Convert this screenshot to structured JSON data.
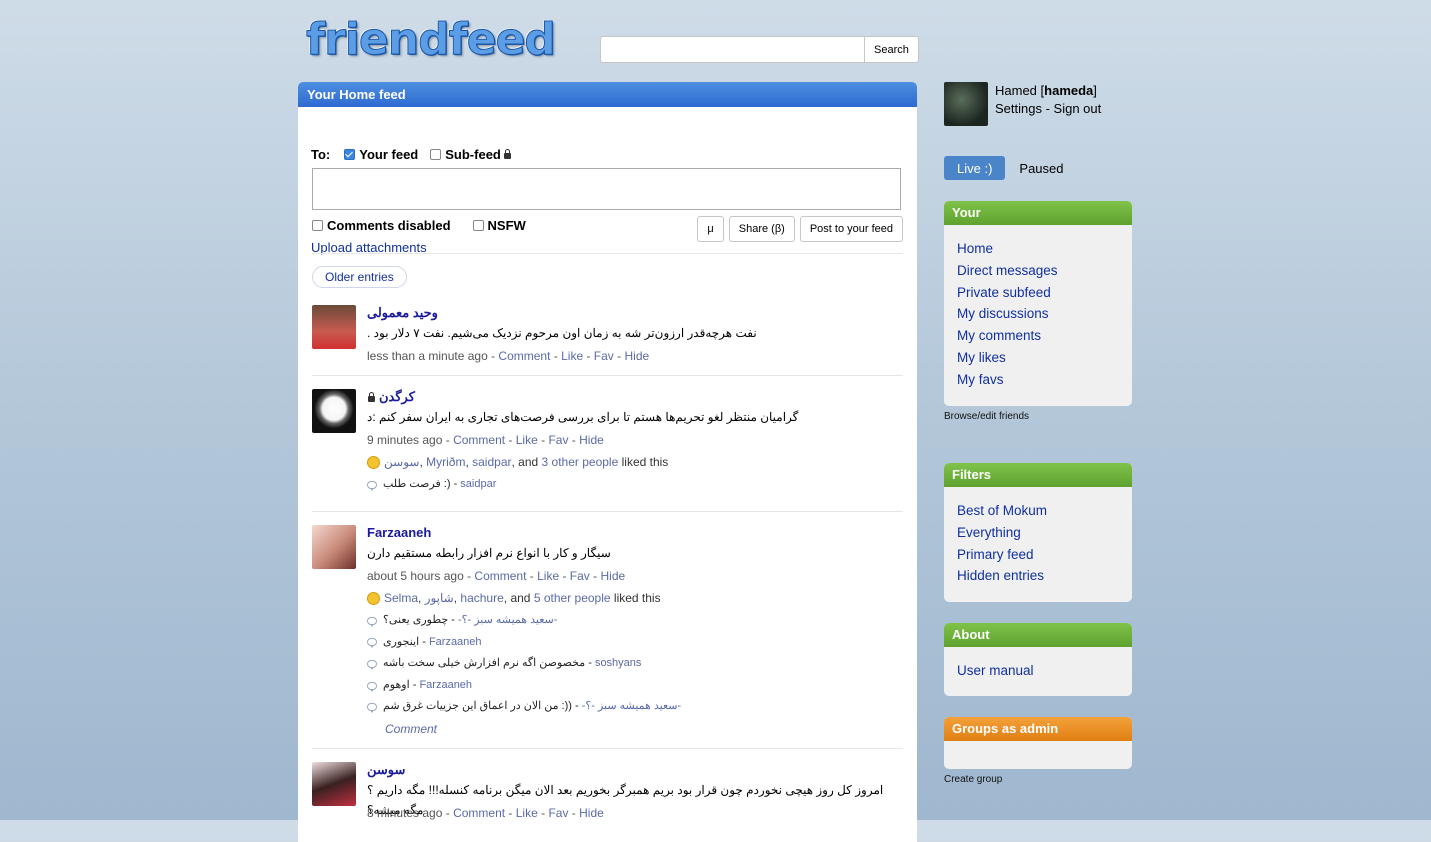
{
  "logo": "friendfeed",
  "search": {
    "placeholder": "",
    "button": "Search"
  },
  "feed": {
    "title": "Your Home feed",
    "to_label": "To:",
    "your_feed": "Your feed",
    "sub_feed": "Sub-feed",
    "comments_disabled": "Comments disabled",
    "nsfw": "NSFW",
    "upload": "Upload attachments",
    "mu_button": "μ",
    "share_button": "Share (β)",
    "post_button": "Post to your feed",
    "older": "Older entries"
  },
  "entries": [
    {
      "author": "وحید معمولی",
      "text": ". نفت هرچه‌قدر ارزون‌تر شه به زمان اون مرحوم نزدیک می‌شیم. نفت ۷ دلار بود",
      "time": "less than a minute ago",
      "actions": [
        "Comment",
        "Like",
        "Fav",
        "Hide"
      ]
    },
    {
      "author": "کرگدن",
      "text": "گرامیان منتظر لغو تحریم‌ها هستم تا برای بررسی فرصت‌های تجاری به ایران سفر کنم :د",
      "time": "9 minutes ago",
      "actions": [
        "Comment",
        "Like",
        "Fav",
        "Hide"
      ],
      "likes": {
        "names": [
          "سوسن",
          "Myriðm",
          "saidpar"
        ],
        "and": ", and",
        "others": "3 other people",
        "suffix": "liked this"
      },
      "comments": [
        {
          "text": "فرصت طلب :)",
          "author": "saidpar"
        }
      ]
    },
    {
      "author": "Farzaaneh",
      "text": "سیگار و کار با انواع نرم افزار رابطه مستقیم دارن",
      "time": "about 5 hours ago",
      "actions": [
        "Comment",
        "Like",
        "Fav",
        "Hide"
      ],
      "likes": {
        "names": [
          "Selma",
          "شاپور",
          "hachure"
        ],
        "and": ", and",
        "others": "5 other people",
        "suffix": "liked this"
      },
      "comments": [
        {
          "text": "چطوری یعنی؟",
          "author": "-سعید همیشه سبز -؟-"
        },
        {
          "text": "اینجوری",
          "author": "Farzaaneh"
        },
        {
          "text": "مخصوصن اگه نرم افزارش خیلی سخت باشه",
          "author": "soshyans"
        },
        {
          "text": "اوهوم",
          "author": "Farzaaneh"
        },
        {
          "text": "من الان در اعماق این جزییات غرق شم :))",
          "author": "-سعید همیشه سبز -؟-"
        }
      ],
      "comment_link": "Comment"
    },
    {
      "author": "سوسن",
      "text": "امروز کل روز هیچی نخوردم چون قرار بود بریم همبرگر بخوریم بعد الان میگن برنامه کنسله!!! مگه داریم ؟ مگه میشه؟",
      "time": "8 minutes ago",
      "actions": [
        "Comment",
        "Like",
        "Fav",
        "Hide"
      ]
    }
  ],
  "profile": {
    "name": "Hamed",
    "username": "hameda",
    "settings": "Settings",
    "signout": "Sign out"
  },
  "live": {
    "live": "Live :)",
    "paused": "Paused"
  },
  "your_box": {
    "title": "Your",
    "items": [
      "Home",
      "Direct messages",
      "Private subfeed",
      "My discussions",
      "My comments",
      "My likes",
      "My favs"
    ],
    "footer": "Browse/edit friends"
  },
  "filters_box": {
    "title": "Filters",
    "items": [
      "Best of Mokum",
      "Everything",
      "Primary feed",
      "Hidden entries"
    ]
  },
  "about_box": {
    "title": "About",
    "items": [
      "User manual"
    ]
  },
  "groups_box": {
    "title": "Groups as admin",
    "footer": "Create group"
  },
  "colors": {
    "header_blue": "#2d6ad1",
    "box_green": "#5ea12e",
    "box_orange": "#df7f14",
    "link": "#1030a0"
  }
}
